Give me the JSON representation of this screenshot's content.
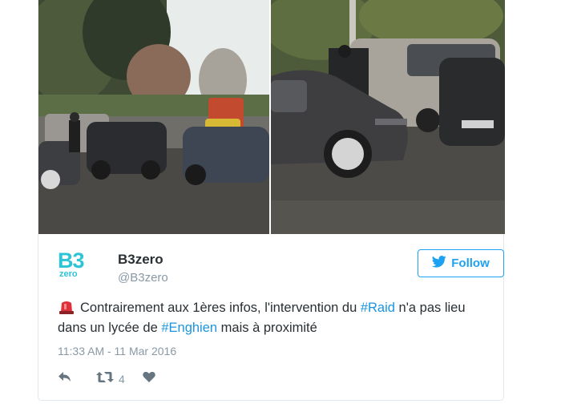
{
  "user": {
    "display_name": "B3zero",
    "handle": "@B3zero",
    "logo_top": "B3",
    "logo_bottom": "zero"
  },
  "follow_button": {
    "label": "Follow"
  },
  "tweet": {
    "text_part1": "Contrairement aux 1ères infos, l'intervention du ",
    "hashtag1": "#Raid",
    "text_part2": " n'a pas lieu dans un lycée de ",
    "hashtag2": "#Enghien",
    "text_part3": " mais à proximité",
    "emoji_icon": "police-light-icon",
    "timestamp": "11:33 AM - 11 Mar 2016"
  },
  "actions": {
    "reply_icon": "reply-icon",
    "retweet_icon": "retweet-icon",
    "retweet_count": "4",
    "like_icon": "heart-icon"
  },
  "colors": {
    "accent": "#1da1f2",
    "hashtag": "#1b95e0",
    "muted": "#8899a6",
    "text": "#292f33",
    "logo": "#2ec4d6"
  }
}
